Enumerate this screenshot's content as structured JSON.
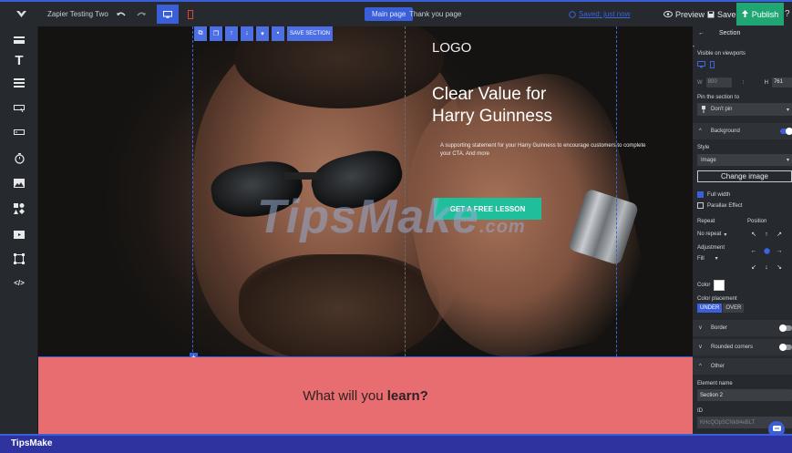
{
  "topbar": {
    "project_name": "Zapier Testing Two",
    "undo_icon": "undo-icon",
    "redo_icon": "redo-icon",
    "desktop_icon": "desktop-icon",
    "mobile_icon": "mobile-icon",
    "pages": [
      "Main page",
      "Thank you page"
    ],
    "saved_status": "Saved: just now",
    "preview_label": "Preview",
    "save_label": "Save",
    "publish_label": "Publish",
    "help_label": "?"
  },
  "sidebar": {
    "tools": [
      "section-icon",
      "text-icon",
      "form-icon",
      "button-icon",
      "input-icon",
      "timer-icon",
      "image-icon",
      "shapes-icon",
      "video-icon",
      "box-icon",
      "code-icon"
    ]
  },
  "section_toolbar": {
    "buttons": [
      "copy-icon",
      "duplicate-icon",
      "move-up-icon",
      "move-down-icon",
      "pin-icon",
      "delete-icon"
    ],
    "save_section_label": "SAVE SECTION"
  },
  "hero": {
    "logo": "LOGO",
    "headline_line1": "Clear Value for",
    "headline_line2": "Harry Guinness",
    "supporting": "A supporting statement for your Harry Guinness to encourage customers to complete your CTA. And more",
    "cta": "GET A FREE LESSON"
  },
  "watermark": {
    "text": "TipsMake",
    "suffix": ".com"
  },
  "second_section": {
    "text_prefix": "What will you ",
    "text_bold": "learn?"
  },
  "panel": {
    "title": "Section",
    "visible_on_viewports": "Visible on viewports",
    "w_label": "W",
    "w_value": "800",
    "h_label": "H",
    "h_value": "761",
    "pin_label": "Pin the section to",
    "pin_value": "Don't pin",
    "background_label": "Background",
    "style_label": "Style",
    "style_value": "Image",
    "change_image": "Change image",
    "full_width": "Full width",
    "parallax": "Parallax Effect",
    "repeat_label": "Repeat",
    "repeat_value": "No repeat",
    "position_label": "Position",
    "adjustment_label": "Adjustment",
    "adjustment_value": "Fill",
    "color_label": "Color",
    "color_value": "#ffffff",
    "color_placement_label": "Color placement",
    "under_label": "UNDER",
    "over_label": "OVER",
    "border_label": "Border",
    "rounded_label": "Rounded corners",
    "other_label": "Other",
    "element_name_label": "Element name",
    "element_name_value": "Section 2",
    "id_label": "ID",
    "id_value": "KHcQOpSCNk84eBLT"
  },
  "footer": {
    "brand": "TipsMake"
  },
  "colors": {
    "accent": "#3a5fd9",
    "publish": "#1fa672",
    "cta": "#1fbf9b",
    "pink_section": "#e86d70",
    "panel_bg": "#26292e"
  }
}
